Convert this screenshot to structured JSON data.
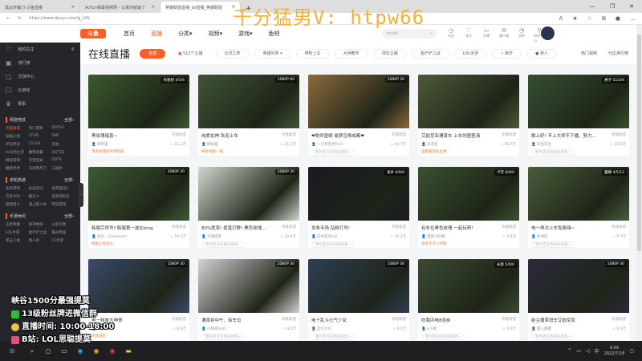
{
  "browser": {
    "tabs": [
      {
        "label": "黑白诈骗刀-斗鱼直播"
      },
      {
        "label": "AcFun弹幕视频网 - 认真你就输了"
      },
      {
        "label": "英雄联盟直播_lol直播_英雄联盟"
      }
    ],
    "url": "https://www.douyu.com/g_LOL",
    "window": {
      "min": "—",
      "max": "❐",
      "close": "✕"
    }
  },
  "watermark": "千分猛男V: htpw66",
  "header": {
    "logo": "斗鱼",
    "nav": [
      "首页",
      "直播",
      "分类▾",
      "视频▾",
      "游戏▾",
      "鱼吧"
    ],
    "search_placeholder": "wiybll",
    "icons": [
      {
        "icon": "history-icon",
        "glyph": "◷",
        "label": "历史"
      },
      {
        "icon": "follow-icon",
        "glyph": "♡",
        "label": "关注"
      },
      {
        "icon": "broadcast-icon",
        "glyph": "▭",
        "label": "开播"
      },
      {
        "icon": "guest-icon",
        "glyph": "✉",
        "label": "客户端"
      },
      {
        "icon": "message-icon",
        "glyph": "◔",
        "label": "消息"
      },
      {
        "icon": "creator-icon",
        "glyph": "⚲",
        "label": "创作中心"
      }
    ]
  },
  "sidebar": {
    "items": [
      {
        "icon": "♡",
        "label": "我的关注",
        "extra": "4"
      },
      {
        "icon": "▣",
        "label": "排行榜"
      },
      {
        "icon": "▢",
        "label": "页游中心"
      },
      {
        "icon": "☐",
        "label": "云游戏"
      },
      {
        "icon": "♛",
        "label": "赛事"
      }
    ],
    "sections": [
      {
        "title": "网游竞技",
        "more": "全部›",
        "items": [
          "英雄联盟",
          "热门游戏",
          "DOTA2",
          "穿越火线",
          "CFHD",
          "DNF",
          "炉石传说",
          "CS:GO",
          "逆战",
          "lol云顶之弈",
          "魔兽争霸",
          "QQ飞车",
          "网易游戏",
          "守望先锋",
          "DOTA",
          "魔兽世界",
          "天涯明月刀",
          "三国杀"
        ],
        "hot": 0
      },
      {
        "title": "单机热游",
        "more": "全部›",
        "items": [
          "主机游戏",
          "永劫无间",
          "生死狙击2",
          "方舟ARK",
          "糖豆人",
          "逃离塔科夫",
          "怪物猎人",
          "海上狼人杀",
          "怀旧游戏"
        ]
      },
      {
        "title": "手游休闲",
        "more": "全部›",
        "items": [
          "王者荣耀",
          "和平精英",
          "火影忍者",
          "LOL手游",
          "金铲铲之战",
          "重返帝国",
          "第五人格",
          "狼人杀",
          "CF手游"
        ]
      }
    ]
  },
  "filter": {
    "title": "在线直播",
    "all": "全部",
    "hot": "512个主播",
    "chips": [
      "云顶之弈",
      "英雄列表 ▾",
      "带粉上车",
      "大神教学",
      "球坛主播",
      "金铲铲之战",
      "LOL手游",
      "⚡ 飙升",
      "● 新人"
    ],
    "right": [
      "热门视频",
      "分区排行榜"
    ]
  },
  "cards": [
    {
      "title": "黑玫瑰暗喜~",
      "cat": "英雄联盟",
      "host": "师师里",
      "heat": "11.2万",
      "tag": "黑色玫瑰砂师师暗喜",
      "badge": "有感想 4/5/6",
      "c": "#3b5a2e"
    },
    {
      "title": "纯爱女神 欢迎上车",
      "cat": "英雄联盟",
      "host": "柳如烟",
      "heat": "11.1万",
      "tag": "峡谷纯爱一班",
      "badge": "1080P 60",
      "c": "#405535"
    },
    {
      "title": "❤牧师墨婉 偷梦召唤成都❤",
      "cat": "英雄联盟",
      "host": "一只卷卷然OvO",
      "heat": "10.7万",
      "tag": "暂时还没有相关勋章~",
      "grey": true,
      "badge": "1080P 30",
      "c": "#8a6a3a"
    },
    {
      "title": "艾欧尼亚通宵车 上车的匪匪请",
      "cat": "英雄联盟",
      "host": "米老鼠",
      "heat": "10.7万",
      "tag": "国服最强女主秀",
      "badge": "",
      "c": "#4c5a38"
    },
    {
      "title": "晚上好! 不上大师不下播、努力...",
      "cat": "英雄联盟",
      "host": "车宝车宝",
      "heat": "10.5万",
      "tag": "暂时还没有相关勋章~",
      "grey": true,
      "badge": "惠子 11/2/4",
      "c": "#365030"
    },
    {
      "title": "韩服宗师号!!韩服第一波比king",
      "cat": "英雄联盟",
      "host": "波比 - Easyboom",
      "heat": "10.5万",
      "tag": "韩服王者波比",
      "badge": "1080P 30",
      "c": "#3e5a34"
    },
    {
      "title": "80%胜率! 提莫打野! 黑色玫瑰...",
      "cat": "英雄联盟",
      "host": "子渊提莫",
      "heat": "10.4万",
      "tag": "暂时还没有相关勋章~",
      "grey": true,
      "badge": "1080P 30",
      "c": "#cfd8d0"
    },
    {
      "title": "发条专场 钻粉打号!",
      "cat": "英雄联盟",
      "host": "白色羽毛zzz",
      "heat": "10.3万",
      "tag": "暂时还没有相关勋章~",
      "grey": true,
      "badge": "发条 0/0/0",
      "c": "#1a1a22"
    },
    {
      "title": "有车位黑色玫瑰 一起玩呀!",
      "cat": "英雄联盟",
      "host": "蛋蛋小阿姨",
      "heat": "9.9万",
      "tag": "峡谷卡莎小阿姨",
      "badge": "卡莎 0/0/0",
      "c": "#3a5030"
    },
    {
      "title": "电一再次上车免费嗨~",
      "cat": "英雄联盟",
      "host": "新闻后",
      "heat": "9.7万",
      "tag": "暂时还没有相关勋章~",
      "grey": true,
      "badge": "露娜 4/5/12",
      "c": "#4a5c3a"
    },
    {
      "title": "电一妹妹大神哥",
      "cat": "英雄联盟",
      "host": "一妹妹",
      "heat": "9.6万",
      "tag": "黑铁战队",
      "badge": "1080P 30",
      "c": "#3a4a6a"
    },
    {
      "title": "通宵到中午、有车位",
      "cat": "英雄联盟",
      "host": "小新哥OuO",
      "heat": "9.5万",
      "tag": "暂时还没有相关勋章~",
      "grey": true,
      "badge": "1080P 30",
      "c": "#d6d2d4"
    },
    {
      "title": "电十乱斗元气少女",
      "cat": "英雄联盟",
      "host": "蓝贝贝贝",
      "heat": "9.5万",
      "tag": "暂时还没有相关勋章~",
      "grey": true,
      "badge": "1080P 30",
      "c": "#2e3f55"
    },
    {
      "title": "吃我闪电8连丝",
      "cat": "英雄联盟",
      "host": "e小德",
      "heat": "9.4万",
      "tag": "暂时还没有相关勋章~",
      "grey": true,
      "badge": "永恩 5/0/0",
      "c": "#3a4a32"
    },
    {
      "title": "新主播草班车艾欧尼亚",
      "cat": "英雄联盟",
      "host": "甜心都都",
      "heat": "9.3万",
      "tag": "暂时还没有相关勋章~",
      "grey": true,
      "badge": "1080P 30",
      "c": "#2a2a3a"
    }
  ],
  "overlay": [
    "峡谷1500分最强提莫",
    "13级粉丝牌进微信群",
    "直播时间: 10:00-18:00",
    "B站: LOL思聪提莫"
  ],
  "taskbar": {
    "time": "9:56",
    "date": "2022/7/18",
    "ime": "中"
  }
}
